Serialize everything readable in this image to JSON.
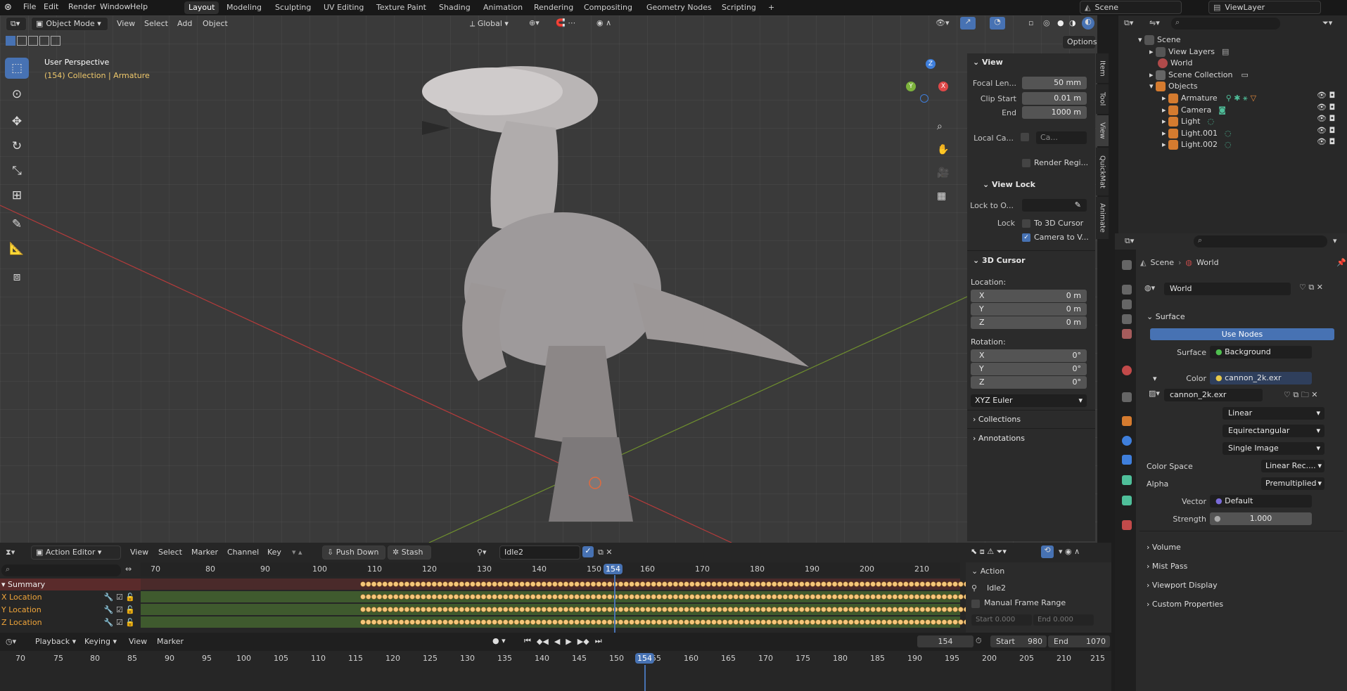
{
  "topbar": {
    "menus": [
      "File",
      "Edit",
      "Render",
      "Window",
      "Help"
    ],
    "workspaces": [
      "Layout",
      "Modeling",
      "Sculpting",
      "UV Editing",
      "Texture Paint",
      "Shading",
      "Animation",
      "Rendering",
      "Compositing",
      "Geometry Nodes",
      "Scripting"
    ],
    "active_workspace": "Layout",
    "add_tab": "+",
    "scene": "Scene",
    "view_layer": "ViewLayer"
  },
  "viewport": {
    "mode": "Object Mode",
    "menus": [
      "View",
      "Select",
      "Add",
      "Object"
    ],
    "transform_orientation": "Global",
    "options": "Options",
    "title": "User Perspective",
    "subtitle": "(154) Collection | Armature",
    "axis_x": "X",
    "axis_y": "Y",
    "axis_z": "Z"
  },
  "npanel": {
    "tabs": [
      "Item",
      "Tool",
      "View",
      "QuickMat",
      "Animate"
    ],
    "view_header": "View",
    "focal_label": "Focal Len...",
    "focal_value": "50 mm",
    "clip_start_label": "Clip Start",
    "clip_start_value": "0.01 m",
    "end_label": "End",
    "end_value": "1000 m",
    "local_camera_label": "Local Ca...",
    "local_camera_value": "Ca...",
    "render_region": "Render Regi...",
    "view_lock_header": "View Lock",
    "lock_to_label": "Lock to O...",
    "lock_label": "Lock",
    "to_3d_cursor": "To 3D Cursor",
    "camera_to_view": "Camera to V...",
    "cursor_header": "3D Cursor",
    "location_label": "Location:",
    "loc_x_label": "X",
    "loc_x": "0 m",
    "loc_y_label": "Y",
    "loc_y": "0 m",
    "loc_z_label": "Z",
    "loc_z": "0 m",
    "rotation_label": "Rotation:",
    "rot_x_label": "X",
    "rot_x": "0°",
    "rot_y_label": "Y",
    "rot_y": "0°",
    "rot_z_label": "Z",
    "rot_z": "0°",
    "rotation_mode": "XYZ Euler",
    "collections": "Collections",
    "annotations": "Annotations"
  },
  "outliner": {
    "items": [
      {
        "label": "Scene",
        "color": "#9a9a9a"
      },
      {
        "label": "View Layers",
        "color": "#9a9a9a"
      },
      {
        "label": "World",
        "color": "#c85a5a"
      },
      {
        "label": "Scene Collection",
        "color": "#d8d8d8"
      },
      {
        "label": "Objects",
        "color": "#e38a3c"
      },
      {
        "label": "Armature",
        "color": "#e38a3c"
      },
      {
        "label": "Camera",
        "color": "#e38a3c"
      },
      {
        "label": "Light",
        "color": "#e38a3c"
      },
      {
        "label": "Light.001",
        "color": "#e38a3c"
      },
      {
        "label": "Light.002",
        "color": "#e38a3c"
      }
    ]
  },
  "properties": {
    "breadcrumb_scene": "Scene",
    "breadcrumb_world": "World",
    "world_name": "World",
    "surface_header": "Surface",
    "use_nodes": "Use Nodes",
    "surface_label": "Surface",
    "surface_value": "Background",
    "color_label": "Color",
    "color_value": "cannon_2k.exr",
    "image_name": "cannon_2k.exr",
    "interpolation": "Linear",
    "projection": "Equirectangular",
    "source": "Single Image",
    "color_space_label": "Color Space",
    "color_space_value": "Linear Rec....",
    "alpha_label": "Alpha",
    "alpha_value": "Premultiplied",
    "vector_label": "Vector",
    "vector_value": "Default",
    "strength_label": "Strength",
    "strength_value": "1.000",
    "sections": [
      "Volume",
      "Mist Pass",
      "Viewport Display",
      "Custom Properties"
    ]
  },
  "action_editor": {
    "editor_mode": "Action Editor",
    "menus": [
      "View",
      "Select",
      "Marker",
      "Channel",
      "Key"
    ],
    "push_down": "Push Down",
    "stash": "Stash",
    "action_name": "Idle2",
    "ruler": [
      "70",
      "80",
      "90",
      "100",
      "110",
      "120",
      "130",
      "140",
      "150",
      "160",
      "170",
      "180",
      "190",
      "200",
      "210"
    ],
    "current_frame": "154",
    "channels": [
      "Summary",
      "X Location",
      "Y Location",
      "Z Location"
    ],
    "side_header": "Action",
    "side_action_name": "Idle2",
    "manual_frame_range": "Manual Frame Range",
    "start_label": "Start",
    "start_value": "0.000",
    "end_label": "End",
    "end_value": "0.000"
  },
  "timeline": {
    "menus": [
      "Playback",
      "Keying",
      "View",
      "Marker"
    ],
    "current_frame": "154",
    "start_label": "Start",
    "start_value": "980",
    "end_label": "End",
    "end_value": "1070",
    "ruler": [
      "70",
      "75",
      "80",
      "85",
      "90",
      "95",
      "100",
      "105",
      "110",
      "115",
      "120",
      "125",
      "130",
      "135",
      "140",
      "145",
      "150",
      "155",
      "160",
      "165",
      "170",
      "175",
      "180",
      "185",
      "190",
      "195",
      "200",
      "205",
      "210",
      "215"
    ]
  }
}
